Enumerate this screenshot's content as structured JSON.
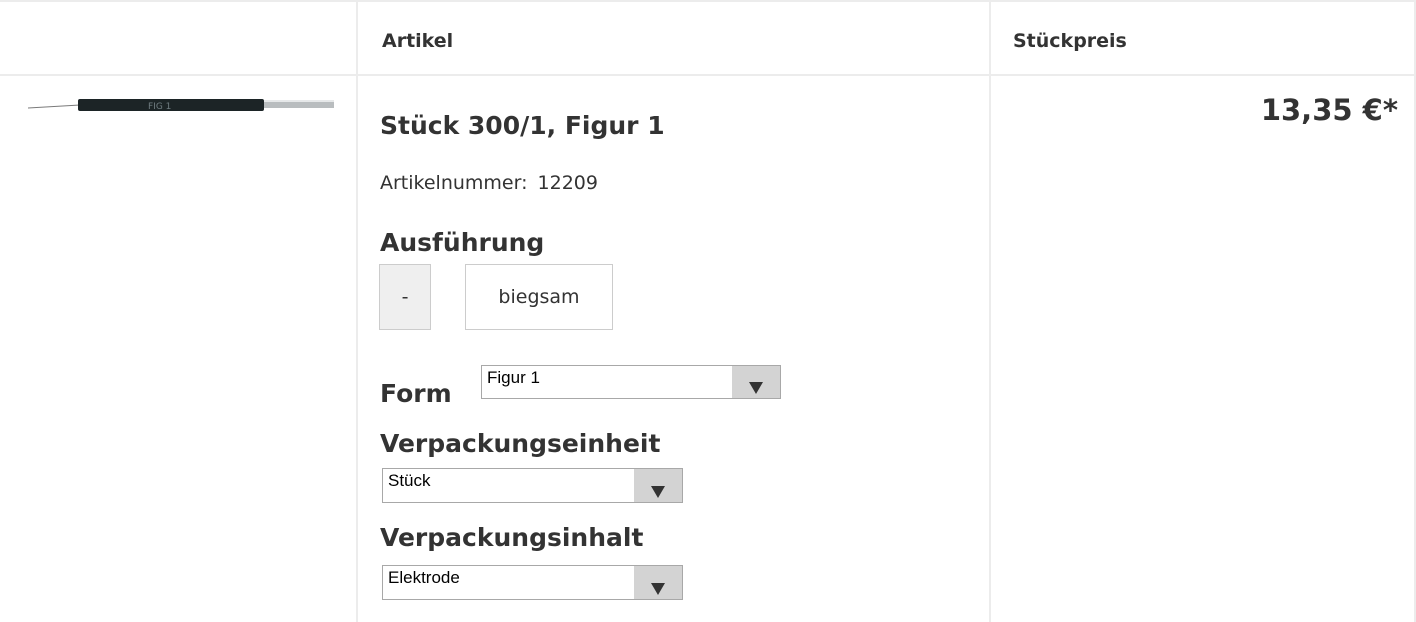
{
  "table": {
    "header": {
      "article": "Artikel",
      "unit_price": "Stückpreis"
    }
  },
  "product": {
    "image_name": "electrode-image",
    "title": "Stück 300/1, Figur 1",
    "article_number_label": "Artikelnummer:",
    "article_number": "12209",
    "price": "13,35 €*"
  },
  "options": {
    "ausfuehrung": {
      "label": "Ausführung",
      "choices": [
        "-",
        "biegsam"
      ]
    },
    "form": {
      "label": "Form",
      "selected": "Figur 1"
    },
    "verpackungseinheit": {
      "label": "Verpackungseinheit",
      "selected": "Stück"
    },
    "verpackungsinhalt": {
      "label": "Verpackungsinhalt",
      "selected": "Elektrode"
    }
  },
  "colors": {
    "text": "#333333",
    "border": "#ececec",
    "select_arrow_bg": "#d3d3d3",
    "option_selected_bg": "#efefef"
  }
}
